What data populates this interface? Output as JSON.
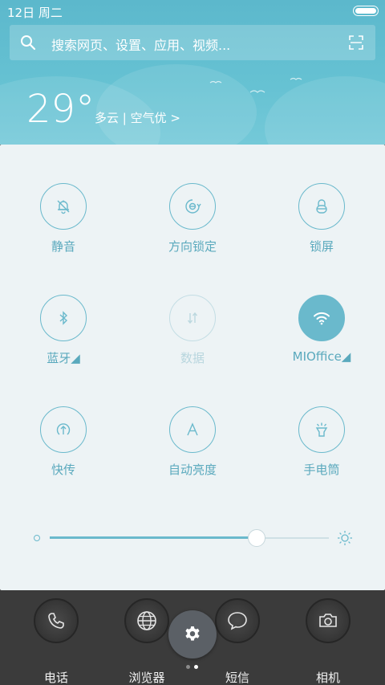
{
  "status_bar": {
    "time": "12日 周二",
    "battery_level": 1.0
  },
  "search": {
    "placeholder": "搜索网页、设置、应用、视频..."
  },
  "weather": {
    "temperature": "29°",
    "description": "多云 | 空气优 >"
  },
  "tiles": [
    {
      "label": "静音",
      "icon": "bell-off-icon",
      "state": "off"
    },
    {
      "label": "方向锁定",
      "icon": "rotation-lock-icon",
      "state": "off"
    },
    {
      "label": "锁屏",
      "icon": "lock-icon",
      "state": "off"
    },
    {
      "label": "蓝牙◢",
      "icon": "bluetooth-icon",
      "state": "off"
    },
    {
      "label": "数据",
      "icon": "data-arrows-icon",
      "state": "disabled"
    },
    {
      "label": "MIOffice◢",
      "icon": "wifi-icon",
      "state": "on"
    },
    {
      "label": "快传",
      "icon": "upload-circle-icon",
      "state": "off"
    },
    {
      "label": "自动亮度",
      "icon": "letter-a-icon",
      "state": "off"
    },
    {
      "label": "手电筒",
      "icon": "flashlight-icon",
      "state": "off"
    }
  ],
  "brightness": {
    "level": 0.74
  },
  "dock": {
    "apps": [
      {
        "label": "电话",
        "icon": "phone-icon"
      },
      {
        "label": "浏览器",
        "icon": "globe-icon"
      },
      {
        "label": "短信",
        "icon": "chat-bubble-icon"
      },
      {
        "label": "相机",
        "icon": "camera-icon"
      }
    ],
    "settings_icon": "gear-icon",
    "page_count": 2,
    "current_page": 2
  },
  "colors": {
    "accent": "#6ab9cc",
    "header_bg": "#5cb8cc",
    "panel_bg": "#edf3f5",
    "dock_bg": "#3b3b3b"
  }
}
